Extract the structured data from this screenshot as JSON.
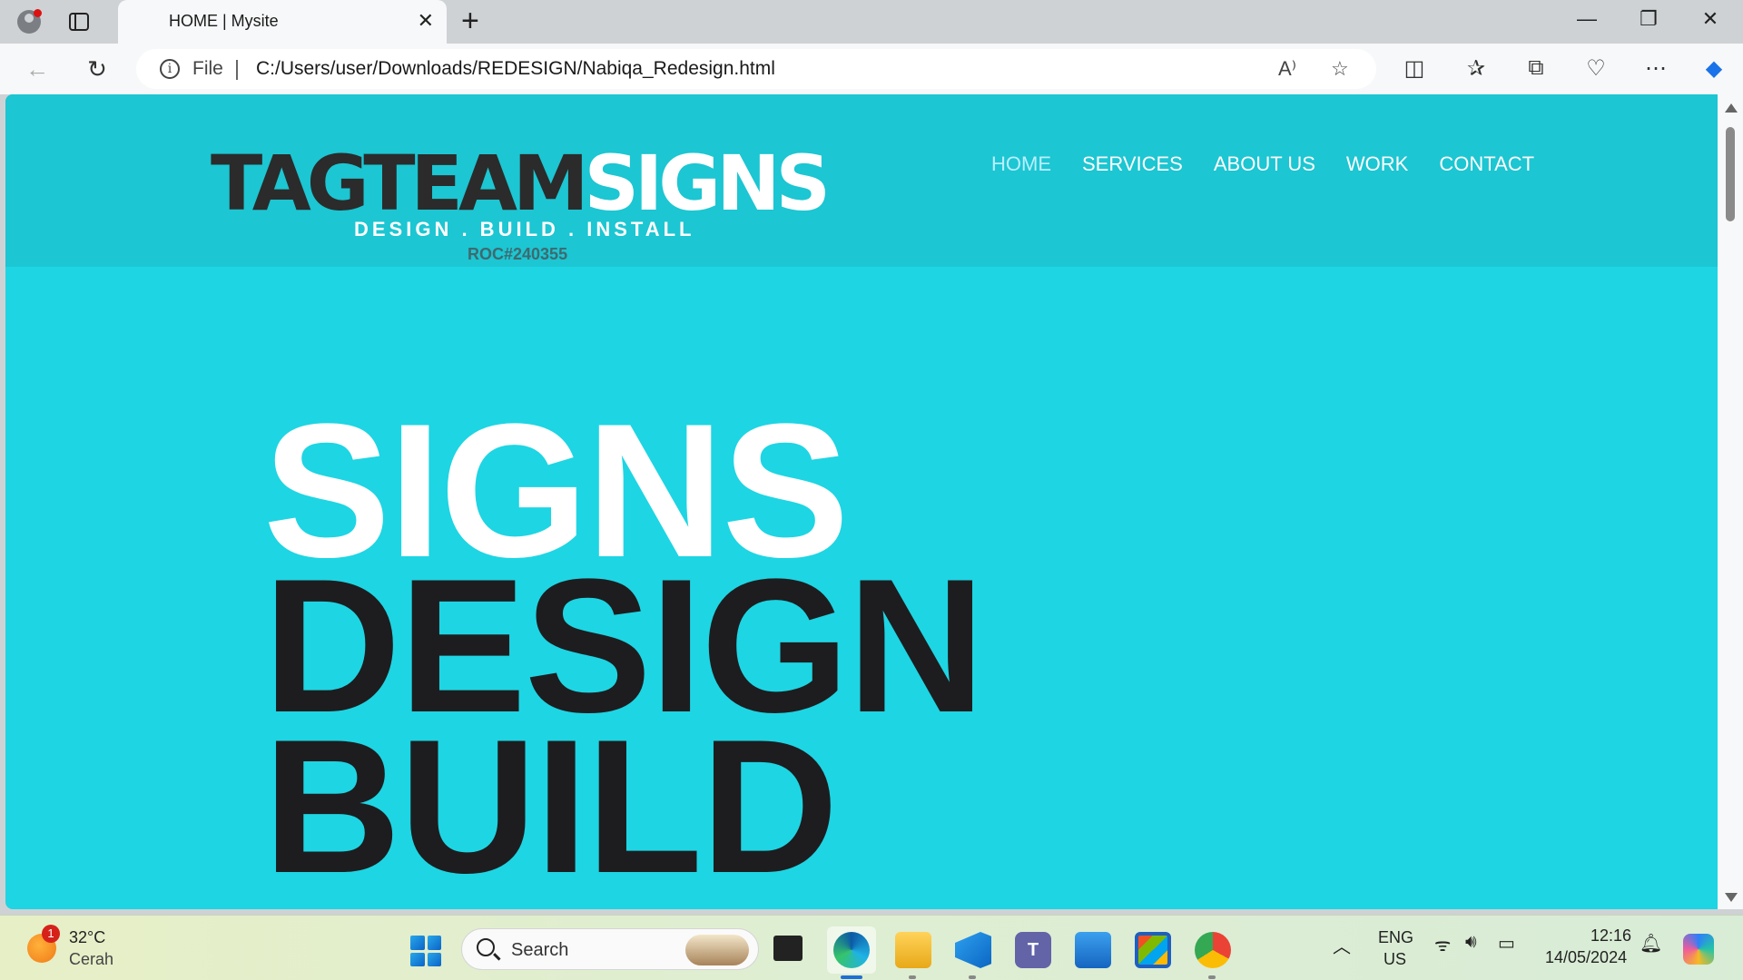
{
  "browser": {
    "tab_title": "HOME | Mysite",
    "address_scheme": "File",
    "address_url": "C:/Users/user/Downloads/REDESIGN/Nabiqa_Redesign.html"
  },
  "site": {
    "logo": {
      "dark_text": "TAGTEAM",
      "light_text": "SIGNS",
      "tagline": "DESIGN . BUILD . INSTALL",
      "roc": "ROC#240355"
    },
    "menu": [
      {
        "label": "HOME",
        "active": true
      },
      {
        "label": "SERVICES"
      },
      {
        "label": "ABOUT US"
      },
      {
        "label": "WORK"
      },
      {
        "label": "CONTACT"
      }
    ],
    "hero": [
      "SIGNS",
      "DESIGN",
      "BUILD"
    ],
    "colors": {
      "header_bg": "#1cc6d2",
      "page_bg": "#1ed5e3",
      "menu_active": "#b9efff"
    }
  },
  "taskbar": {
    "weather_temp": "32°C",
    "weather_desc": "Cerah",
    "weather_badge": "1",
    "search_placeholder": "Search",
    "lang_1": "ENG",
    "lang_2": "US",
    "time": "12:16",
    "date": "14/05/2024"
  }
}
